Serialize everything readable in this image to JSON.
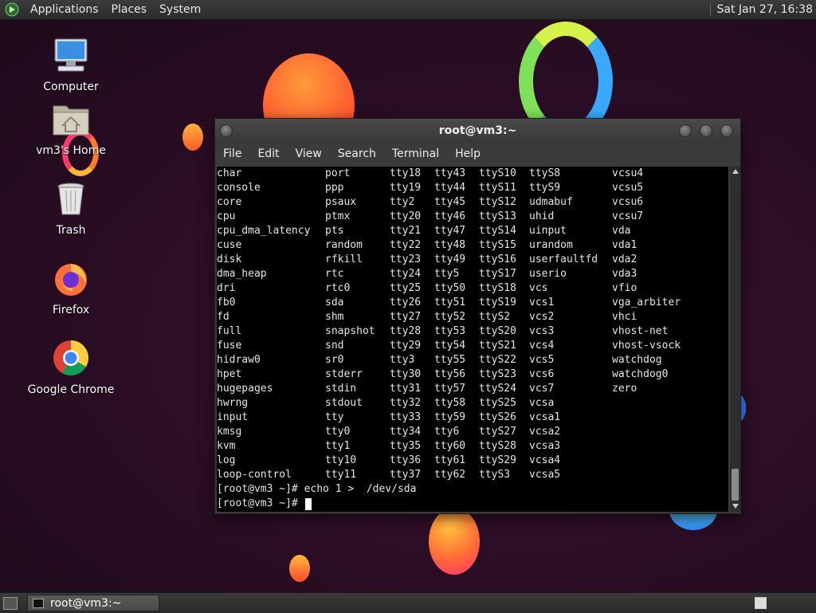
{
  "top_panel": {
    "menus": [
      "Applications",
      "Places",
      "System"
    ],
    "clock": "Sat Jan 27, 16:38"
  },
  "desktop": {
    "icons": [
      {
        "label": "Computer",
        "icon": "computer-icon"
      },
      {
        "label": "vm3's Home",
        "icon": "home-folder-icon"
      },
      {
        "label": "Trash",
        "icon": "trash-icon"
      },
      {
        "label": "Firefox",
        "icon": "firefox-icon"
      },
      {
        "label": "Google Chrome",
        "icon": "chrome-icon"
      }
    ]
  },
  "terminal": {
    "title": "root@vm3:~",
    "menu": [
      "File",
      "Edit",
      "View",
      "Search",
      "Terminal",
      "Help"
    ],
    "columns": [
      [
        "char",
        "console",
        "core",
        "cpu",
        "cpu_dma_latency",
        "cuse",
        "disk",
        "dma_heap",
        "dri",
        "fb0",
        "fd",
        "full",
        "fuse",
        "hidraw0",
        "hpet",
        "hugepages",
        "hwrng",
        "input",
        "kmsg",
        "kvm",
        "log",
        "loop-control"
      ],
      [
        "port",
        "ppp",
        "psaux",
        "ptmx",
        "pts",
        "random",
        "rfkill",
        "rtc",
        "rtc0",
        "sda",
        "shm",
        "snapshot",
        "snd",
        "sr0",
        "stderr",
        "stdin",
        "stdout",
        "tty",
        "tty0",
        "tty1",
        "tty10",
        "tty11"
      ],
      [
        "tty18",
        "tty19",
        "tty2",
        "tty20",
        "tty21",
        "tty22",
        "tty23",
        "tty24",
        "tty25",
        "tty26",
        "tty27",
        "tty28",
        "tty29",
        "tty3",
        "tty30",
        "tty31",
        "tty32",
        "tty33",
        "tty34",
        "tty35",
        "tty36",
        "tty37"
      ],
      [
        "tty43",
        "tty44",
        "tty45",
        "tty46",
        "tty47",
        "tty48",
        "tty49",
        "tty5",
        "tty50",
        "tty51",
        "tty52",
        "tty53",
        "tty54",
        "tty55",
        "tty56",
        "tty57",
        "tty58",
        "tty59",
        "tty6",
        "tty60",
        "tty61",
        "tty62"
      ],
      [
        "ttyS10",
        "ttyS11",
        "ttyS12",
        "ttyS13",
        "ttyS14",
        "ttyS15",
        "ttyS16",
        "ttyS17",
        "ttyS18",
        "ttyS19",
        "ttyS2",
        "ttyS20",
        "ttyS21",
        "ttyS22",
        "ttyS23",
        "ttyS24",
        "ttyS25",
        "ttyS26",
        "ttyS27",
        "ttyS28",
        "ttyS29",
        "ttyS3"
      ],
      [
        "ttyS8",
        "ttyS9",
        "udmabuf",
        "uhid",
        "uinput",
        "urandom",
        "userfaultfd",
        "userio",
        "vcs",
        "vcs1",
        "vcs2",
        "vcs3",
        "vcs4",
        "vcs5",
        "vcs6",
        "vcs7",
        "vcsa",
        "vcsa1",
        "vcsa2",
        "vcsa3",
        "vcsa4",
        "vcsa5"
      ],
      [
        "vcsu4",
        "vcsu5",
        "vcsu6",
        "vcsu7",
        "vda",
        "vda1",
        "vda2",
        "vda3",
        "vfio",
        "vga_arbiter",
        "vhci",
        "vhost-net",
        "vhost-vsock",
        "watchdog",
        "watchdog0",
        "zero",
        "",
        "",
        "",
        "",
        "",
        ""
      ]
    ],
    "prompt_lines": [
      "[root@vm3 ~]# echo 1 >  /dev/sda",
      "[root@vm3 ~]# "
    ]
  },
  "taskbar": {
    "tasks": [
      {
        "label": "root@vm3:~",
        "icon": "terminal-icon"
      }
    ]
  }
}
